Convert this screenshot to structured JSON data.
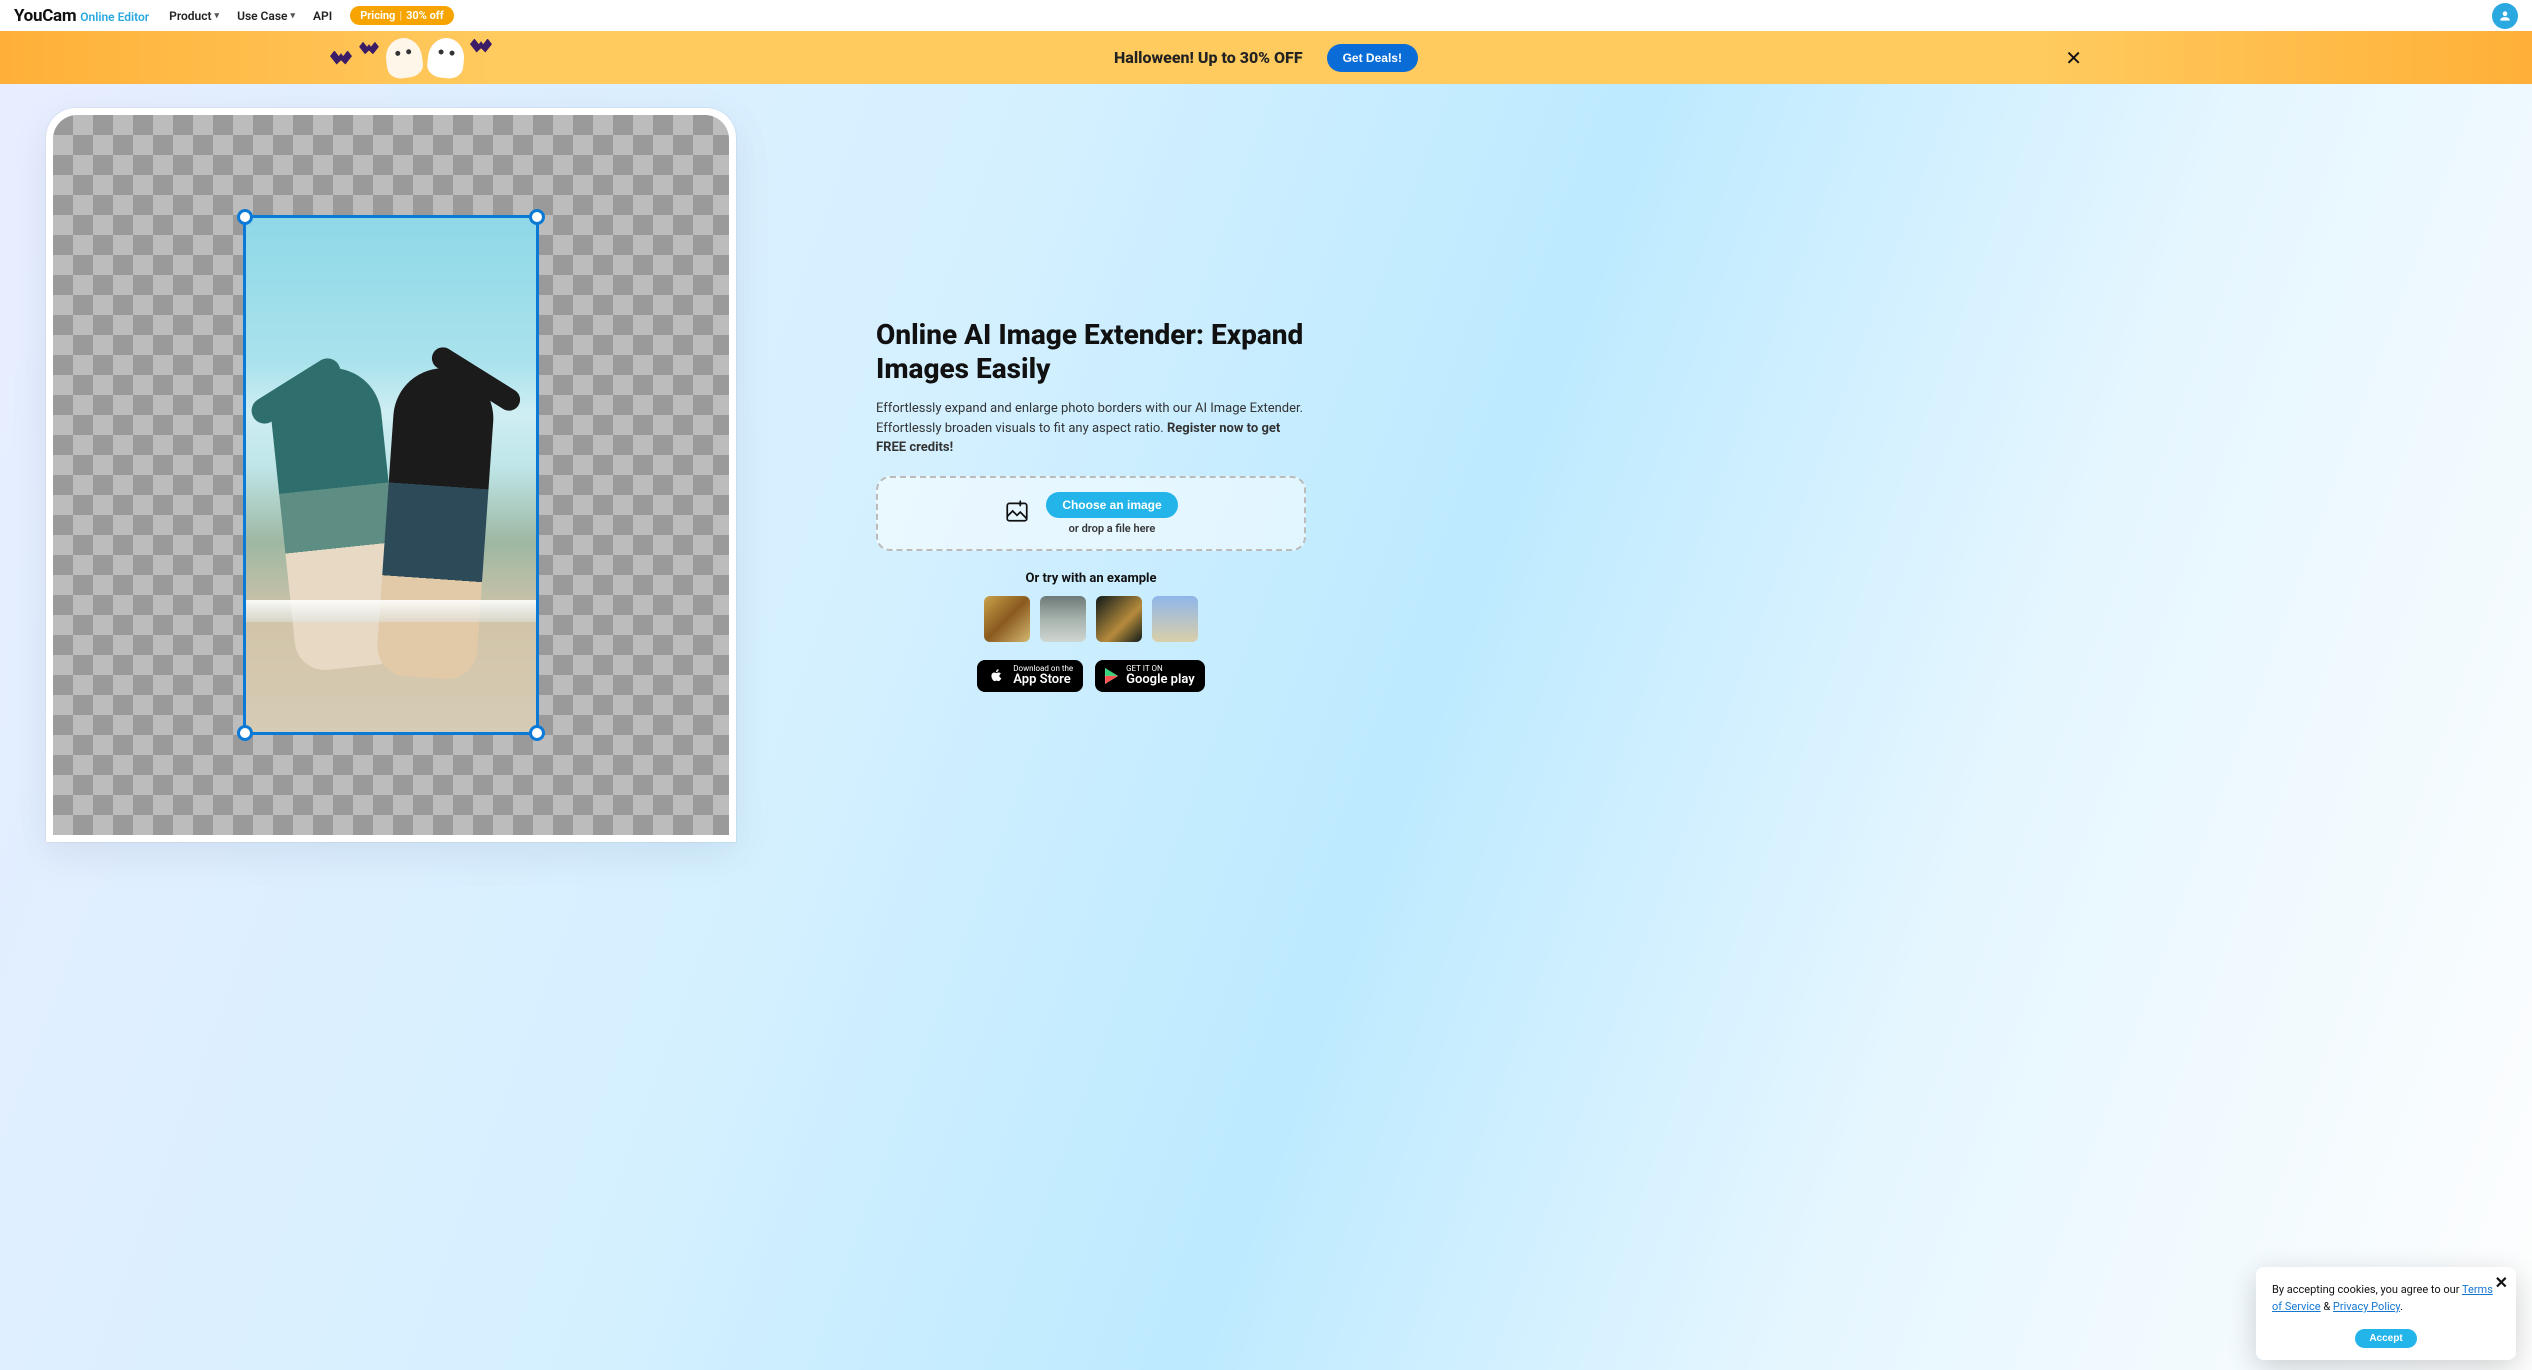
{
  "nav": {
    "logo_main": "YouCam",
    "logo_sub": "Online Editor",
    "items": [
      "Product",
      "Use Case",
      "API"
    ],
    "pricing_label": "Pricing",
    "pricing_discount": "30% off"
  },
  "promo": {
    "text": "Halloween! Up to 30% OFF",
    "cta": "Get Deals!"
  },
  "hero": {
    "title": "Online AI Image Extender: Expand Images Easily",
    "desc_plain": "Effortlessly expand and enlarge photo borders with our AI Image Extender. Effortlessly broaden visuals to fit any aspect ratio. ",
    "desc_bold": "Register now to get FREE credits!",
    "choose_label": "Choose an image",
    "drop_label": "or drop a file here",
    "examples_label": "Or try with an example",
    "appstore_small": "Download on the",
    "appstore_big": "App Store",
    "google_small": "GET IT ON",
    "google_big": "Google play"
  },
  "cookie": {
    "pre": "By accepting cookies, you agree to our ",
    "tos": "Terms of Service",
    "amp": " & ",
    "pp": "Privacy Policy",
    "suffix": ".",
    "accept": "Accept"
  }
}
